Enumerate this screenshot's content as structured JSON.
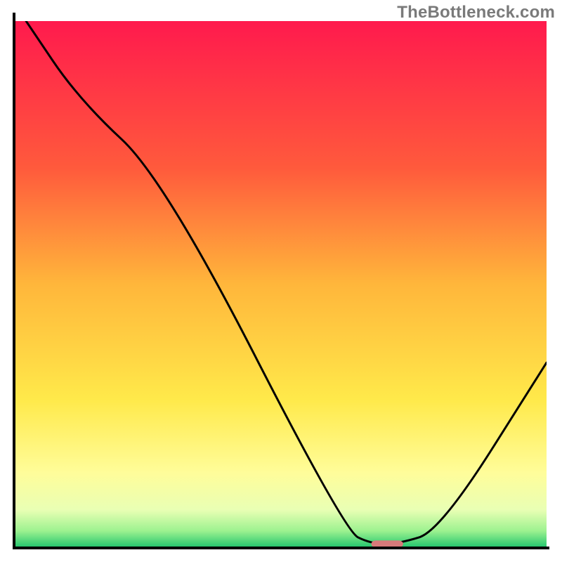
{
  "watermark": "TheBottleneck.com",
  "chart_data": {
    "type": "line",
    "title": "",
    "xlabel": "",
    "ylabel": "",
    "xlim": [
      0,
      100
    ],
    "ylim": [
      0,
      100
    ],
    "series": [
      {
        "name": "bottleneck-curve",
        "x": [
          2,
          12,
          28,
          62,
          67,
          72,
          80,
          100
        ],
        "y": [
          100,
          85,
          70,
          3,
          0.5,
          0.5,
          3,
          35
        ]
      }
    ],
    "marker": {
      "x_start": 67,
      "x_end": 73,
      "y": 0.5
    },
    "gradient_stops": [
      {
        "pct": 0,
        "color": "#ff1a4d"
      },
      {
        "pct": 28,
        "color": "#ff5a3c"
      },
      {
        "pct": 50,
        "color": "#ffb63b"
      },
      {
        "pct": 72,
        "color": "#ffe94a"
      },
      {
        "pct": 86,
        "color": "#fffd9a"
      },
      {
        "pct": 93,
        "color": "#e9ffb4"
      },
      {
        "pct": 97,
        "color": "#9df290"
      },
      {
        "pct": 100,
        "color": "#28c76f"
      }
    ]
  }
}
